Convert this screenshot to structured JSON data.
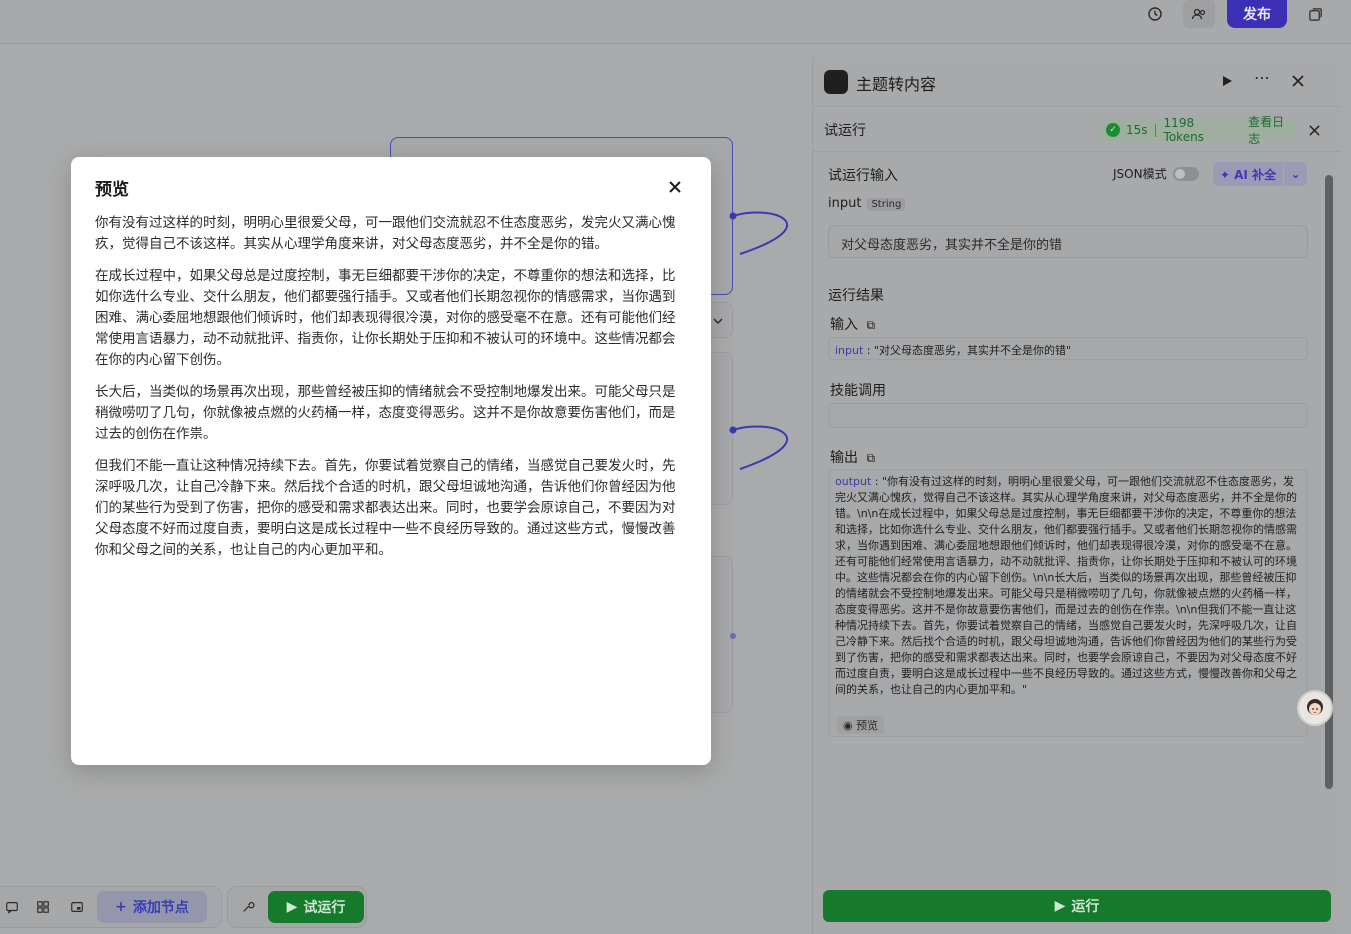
{
  "topbar": {
    "publish_label": "发布",
    "icons": [
      "history-icon",
      "collaborators-icon",
      "copy-window-icon"
    ]
  },
  "toolbar": {
    "add_node_label": "添加节点",
    "trial_run_label": "试运行"
  },
  "panel": {
    "title": "主题转内容",
    "trial_run_label": "试运行",
    "status": {
      "duration": "15s",
      "tokens": "1198 Tokens",
      "view_log": "查看日志"
    },
    "trial_input": {
      "title": "试运行输入",
      "json_mode_label": "JSON模式",
      "ai_complete_label": "AI 补全",
      "field_name": "input",
      "field_type": "String",
      "field_value": "对父母态度恶劣，其实并不全是你的错"
    },
    "result": {
      "title": "运行结果",
      "input_label": "输入",
      "input_key": "input",
      "input_value": "\"对父母态度恶劣，其实并不全是你的错\"",
      "skill_label": "技能调用",
      "output_label": "输出",
      "output_key": "output",
      "output_value": "\"你有没有过这样的时刻，明明心里很爱父母，可一跟他们交流就忍不住态度恶劣，发完火又满心愧疚，觉得自己不该这样。其实从心理学角度来讲，对父母态度恶劣，并不全是你的错。\\n\\n在成长过程中，如果父母总是过度控制，事无巨细都要干涉你的决定，不尊重你的想法和选择，比如你选什么专业、交什么朋友，他们都要强行插手。又或者他们长期忽视你的情感需求，当你遇到困难、满心委屈地想跟他们倾诉时，他们却表现得很冷漠，对你的感受毫不在意。还有可能他们经常使用言语暴力，动不动就批评、指责你，让你长期处于压抑和不被认可的环境中。这些情况都会在你的内心留下创伤。\\n\\n长大后，当类似的场景再次出现，那些曾经被压抑的情绪就会不受控制地爆发出来。可能父母只是稍微唠叨了几句，你就像被点燃的火药桶一样，态度变得恶劣。这并不是你故意要伤害他们，而是过去的创伤在作祟。\\n\\n但我们不能一直让这种情况持续下去。首先，你要试着觉察自己的情绪，当感觉自己要发火时，先深呼吸几次，让自己冷静下来。然后找个合适的时机，跟父母坦诚地沟通，告诉他们你曾经因为他们的某些行为受到了伤害，把你的感受和需求都表达出来。同时，也要学会原谅自己，不要因为对父母态度不好而过度自责，要明白这是成长过程中一些不良经历导致的。通过这些方式，慢慢改善你和父母之间的关系，也让自己的内心更加平和。\"",
      "preview_label": "预览"
    },
    "run_label": "运行"
  },
  "modal": {
    "title": "预览",
    "paragraphs": [
      "你有没有过这样的时刻，明明心里很爱父母，可一跟他们交流就忍不住态度恶劣，发完火又满心愧疚，觉得自己不该这样。其实从心理学角度来讲，对父母态度恶劣，并不全是你的错。",
      "在成长过程中，如果父母总是过度控制，事无巨细都要干涉你的决定，不尊重你的想法和选择，比如你选什么专业、交什么朋友，他们都要强行插手。又或者他们长期忽视你的情感需求，当你遇到困难、满心委屈地想跟他们倾诉时，他们却表现得很冷漠，对你的感受毫不在意。还有可能他们经常使用言语暴力，动不动就批评、指责你，让你长期处于压抑和不被认可的环境中。这些情况都会在你的内心留下创伤。",
      "长大后，当类似的场景再次出现，那些曾经被压抑的情绪就会不受控制地爆发出来。可能父母只是稍微唠叨了几句，你就像被点燃的火药桶一样，态度变得恶劣。这并不是你故意要伤害他们，而是过去的创伤在作祟。",
      "但我们不能一直让这种情况持续下去。首先，你要试着觉察自己的情绪，当感觉自己要发火时，先深呼吸几次，让自己冷静下来。然后找个合适的时机，跟父母坦诚地沟通，告诉他们你曾经因为他们的某些行为受到了伤害，把你的感受和需求都表达出来。同时，也要学会原谅自己，不要因为对父母态度不好而过度自责，要明白这是成长过程中一些不良经历导致的。通过这些方式，慢慢改善你和父母之间的关系，也让自己的内心更加平和。"
    ]
  },
  "colors": {
    "publish": "#3a2fb5",
    "run_green": "#157a2b",
    "overlay": "#a9aaab"
  }
}
